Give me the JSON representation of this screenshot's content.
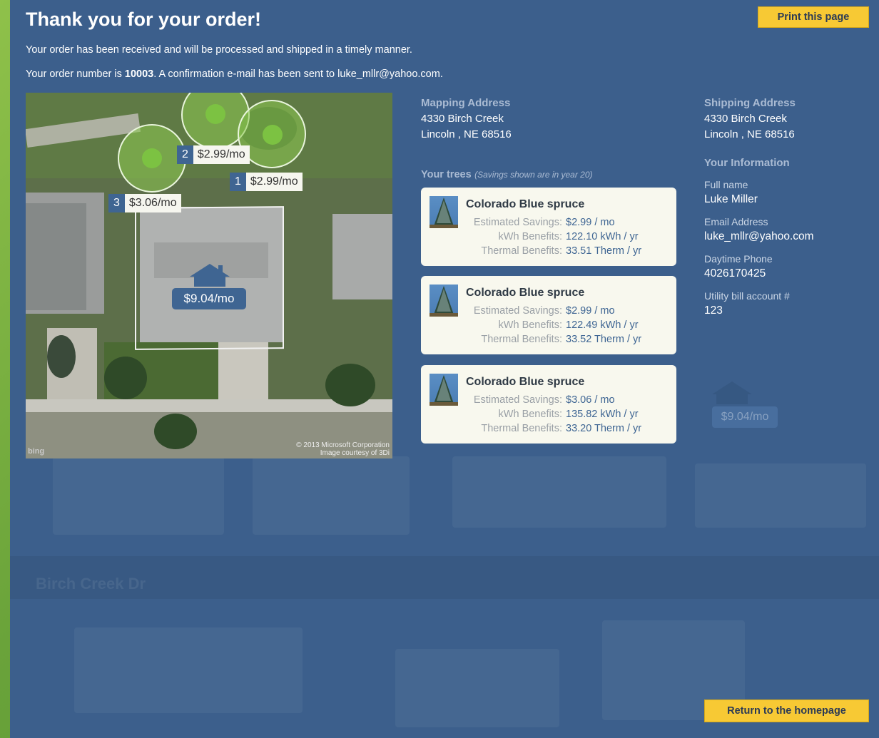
{
  "header": {
    "title": "Thank you for your order!",
    "line1": "Your order has been received and will be processed and shipped in a timely manner.",
    "line2_prefix": "Your order number is ",
    "order_number": "10003",
    "line2_suffix": ". A confirmation e-mail has been sent to luke_mllr@yahoo.com."
  },
  "buttons": {
    "print": "Print this page",
    "home": "Return to the homepage"
  },
  "map": {
    "tags": [
      {
        "num": "2",
        "amount": "$2.99/mo"
      },
      {
        "num": "1",
        "amount": "$2.99/mo"
      },
      {
        "num": "3",
        "amount": "$3.06/mo"
      }
    ],
    "house_savings": "$9.04/mo",
    "credit_line1": "© 2013 Microsoft Corporation",
    "credit_line2": "Image courtesy of 3Di",
    "logo": "bing"
  },
  "mapping_address": {
    "label": "Mapping Address",
    "street": "4330 Birch Creek",
    "city": "Lincoln , NE 68516"
  },
  "shipping_address": {
    "label": "Shipping Address",
    "street": "4330 Birch Creek",
    "city": "Lincoln , NE 68516"
  },
  "trees_section": {
    "title": "Your trees",
    "note": "(Savings shown are in year 20)",
    "labels": {
      "savings": "Estimated Savings:",
      "kwh": "kWh Benefits:",
      "thermal": "Thermal Benefits:"
    },
    "trees": [
      {
        "name": "Colorado Blue spruce",
        "savings": "$2.99 / mo",
        "kwh": "122.10 kWh / yr",
        "thermal": "33.51 Therm / yr"
      },
      {
        "name": "Colorado Blue spruce",
        "savings": "$2.99 / mo",
        "kwh": "122.49 kWh / yr",
        "thermal": "33.52 Therm / yr"
      },
      {
        "name": "Colorado Blue spruce",
        "savings": "$3.06 / mo",
        "kwh": "135.82 kWh / yr",
        "thermal": "33.20 Therm / yr"
      }
    ]
  },
  "your_info": {
    "label": "Your Information",
    "fullname_label": "Full name",
    "fullname": "Luke Miller",
    "email_label": "Email Address",
    "email": "luke_mllr@yahoo.com",
    "phone_label": "Daytime Phone",
    "phone": "4026170425",
    "account_label": "Utility bill account #",
    "account": "123"
  },
  "background": {
    "house_savings": "$9.04/mo",
    "street_name": "Birch Creek Dr"
  },
  "colors": {
    "panel": "#3c5f8c",
    "button": "#f7c934",
    "accent": "#3e6593"
  }
}
